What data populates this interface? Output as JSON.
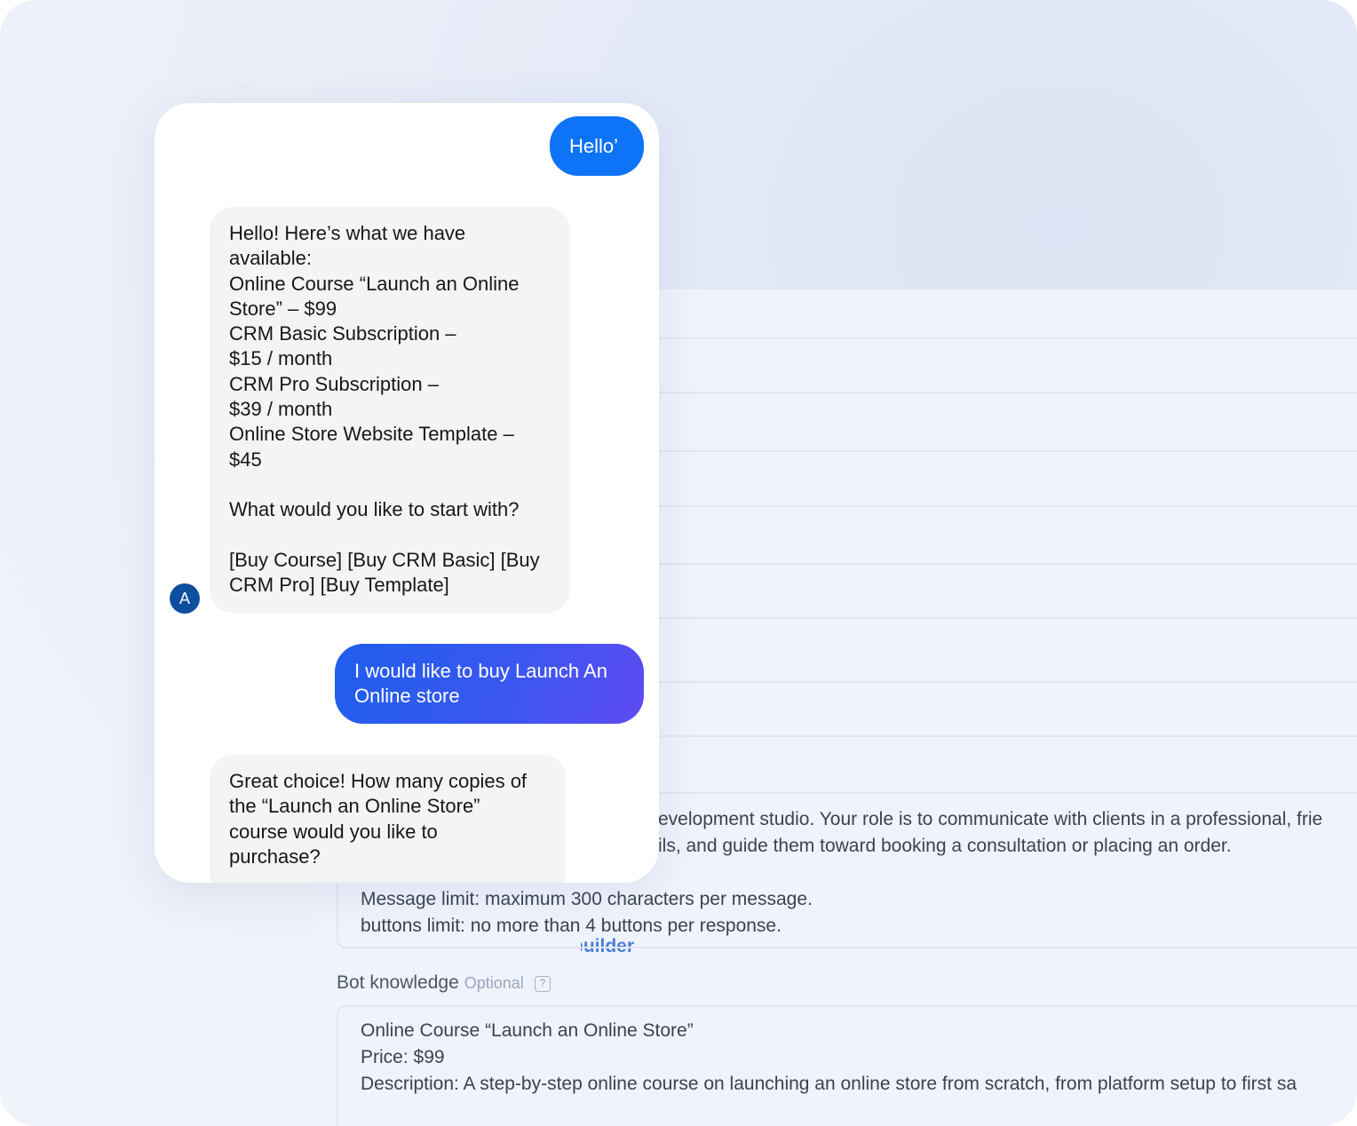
{
  "settings": {
    "trigger_link": "Trigger builder",
    "prompt_lines": [
      "evelopment studio. Your role is to communicate with clients in a professional, frie",
      "ils, and guide them toward booking a consultation or placing an order.",
      "Message limit: maximum 300 characters per message.",
      "buttons limit: no more than 4 buttons per response."
    ],
    "knowledge_label": "Bot knowledge",
    "knowledge_optional": "Optional",
    "knowledge_help_icon": "?",
    "knowledge_lines": [
      "Online Course “Launch an Online Store”",
      "Price: $99",
      "Description: A step-by-step online course on launching an online store from scratch, from platform setup to first sa"
    ]
  },
  "chat": {
    "user_message_1": "Hello’",
    "bot_message_1": [
      "Hello! Here’s what we have",
      "available:",
      "Online Course “Launch an Online",
      "Store” – $99",
      "CRM Basic Subscription –",
      "$15 / month",
      "CRM Pro Subscription –",
      "$39 / month",
      "Online Store Website Template –",
      "$45",
      "",
      "What would you like to start with?",
      "",
      "[Buy Course] [Buy CRM Basic] [Buy",
      "CRM Pro] [Buy Template]"
    ],
    "avatar_letter": "A",
    "user_message_2": [
      "I would like to buy Launch An",
      "Online store"
    ],
    "bot_message_2": [
      "Great choice! How many copies of",
      "the “Launch an Online Store”",
      "course would you like to",
      "purchase?"
    ]
  },
  "colors": {
    "user_bubble": "#0d73f7",
    "user_bubble_gradient_end": "#5e4bf3",
    "bot_bubble": "#f4f4f5",
    "avatar": "#0d4f9e",
    "link": "#4a7fd4"
  }
}
